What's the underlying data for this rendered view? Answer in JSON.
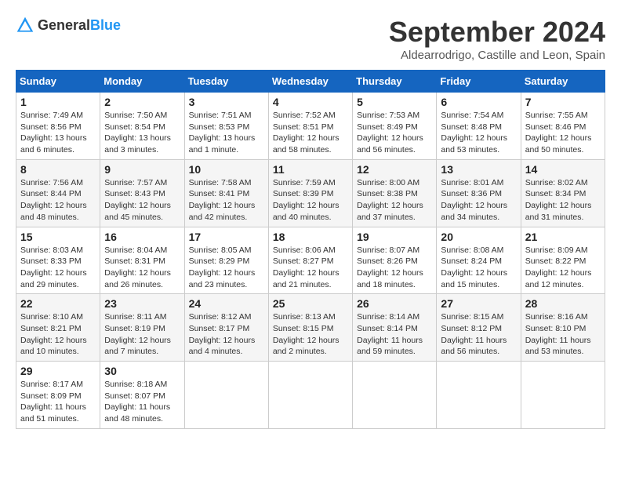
{
  "logo": {
    "text_general": "General",
    "text_blue": "Blue"
  },
  "title": "September 2024",
  "subtitle": "Aldearrodrigo, Castille and Leon, Spain",
  "headers": [
    "Sunday",
    "Monday",
    "Tuesday",
    "Wednesday",
    "Thursday",
    "Friday",
    "Saturday"
  ],
  "weeks": [
    [
      {
        "day": "1",
        "detail": "Sunrise: 7:49 AM\nSunset: 8:56 PM\nDaylight: 13 hours\nand 6 minutes."
      },
      {
        "day": "2",
        "detail": "Sunrise: 7:50 AM\nSunset: 8:54 PM\nDaylight: 13 hours\nand 3 minutes."
      },
      {
        "day": "3",
        "detail": "Sunrise: 7:51 AM\nSunset: 8:53 PM\nDaylight: 13 hours\nand 1 minute."
      },
      {
        "day": "4",
        "detail": "Sunrise: 7:52 AM\nSunset: 8:51 PM\nDaylight: 12 hours\nand 58 minutes."
      },
      {
        "day": "5",
        "detail": "Sunrise: 7:53 AM\nSunset: 8:49 PM\nDaylight: 12 hours\nand 56 minutes."
      },
      {
        "day": "6",
        "detail": "Sunrise: 7:54 AM\nSunset: 8:48 PM\nDaylight: 12 hours\nand 53 minutes."
      },
      {
        "day": "7",
        "detail": "Sunrise: 7:55 AM\nSunset: 8:46 PM\nDaylight: 12 hours\nand 50 minutes."
      }
    ],
    [
      {
        "day": "8",
        "detail": "Sunrise: 7:56 AM\nSunset: 8:44 PM\nDaylight: 12 hours\nand 48 minutes."
      },
      {
        "day": "9",
        "detail": "Sunrise: 7:57 AM\nSunset: 8:43 PM\nDaylight: 12 hours\nand 45 minutes."
      },
      {
        "day": "10",
        "detail": "Sunrise: 7:58 AM\nSunset: 8:41 PM\nDaylight: 12 hours\nand 42 minutes."
      },
      {
        "day": "11",
        "detail": "Sunrise: 7:59 AM\nSunset: 8:39 PM\nDaylight: 12 hours\nand 40 minutes."
      },
      {
        "day": "12",
        "detail": "Sunrise: 8:00 AM\nSunset: 8:38 PM\nDaylight: 12 hours\nand 37 minutes."
      },
      {
        "day": "13",
        "detail": "Sunrise: 8:01 AM\nSunset: 8:36 PM\nDaylight: 12 hours\nand 34 minutes."
      },
      {
        "day": "14",
        "detail": "Sunrise: 8:02 AM\nSunset: 8:34 PM\nDaylight: 12 hours\nand 31 minutes."
      }
    ],
    [
      {
        "day": "15",
        "detail": "Sunrise: 8:03 AM\nSunset: 8:33 PM\nDaylight: 12 hours\nand 29 minutes."
      },
      {
        "day": "16",
        "detail": "Sunrise: 8:04 AM\nSunset: 8:31 PM\nDaylight: 12 hours\nand 26 minutes."
      },
      {
        "day": "17",
        "detail": "Sunrise: 8:05 AM\nSunset: 8:29 PM\nDaylight: 12 hours\nand 23 minutes."
      },
      {
        "day": "18",
        "detail": "Sunrise: 8:06 AM\nSunset: 8:27 PM\nDaylight: 12 hours\nand 21 minutes."
      },
      {
        "day": "19",
        "detail": "Sunrise: 8:07 AM\nSunset: 8:26 PM\nDaylight: 12 hours\nand 18 minutes."
      },
      {
        "day": "20",
        "detail": "Sunrise: 8:08 AM\nSunset: 8:24 PM\nDaylight: 12 hours\nand 15 minutes."
      },
      {
        "day": "21",
        "detail": "Sunrise: 8:09 AM\nSunset: 8:22 PM\nDaylight: 12 hours\nand 12 minutes."
      }
    ],
    [
      {
        "day": "22",
        "detail": "Sunrise: 8:10 AM\nSunset: 8:21 PM\nDaylight: 12 hours\nand 10 minutes."
      },
      {
        "day": "23",
        "detail": "Sunrise: 8:11 AM\nSunset: 8:19 PM\nDaylight: 12 hours\nand 7 minutes."
      },
      {
        "day": "24",
        "detail": "Sunrise: 8:12 AM\nSunset: 8:17 PM\nDaylight: 12 hours\nand 4 minutes."
      },
      {
        "day": "25",
        "detail": "Sunrise: 8:13 AM\nSunset: 8:15 PM\nDaylight: 12 hours\nand 2 minutes."
      },
      {
        "day": "26",
        "detail": "Sunrise: 8:14 AM\nSunset: 8:14 PM\nDaylight: 11 hours\nand 59 minutes."
      },
      {
        "day": "27",
        "detail": "Sunrise: 8:15 AM\nSunset: 8:12 PM\nDaylight: 11 hours\nand 56 minutes."
      },
      {
        "day": "28",
        "detail": "Sunrise: 8:16 AM\nSunset: 8:10 PM\nDaylight: 11 hours\nand 53 minutes."
      }
    ],
    [
      {
        "day": "29",
        "detail": "Sunrise: 8:17 AM\nSunset: 8:09 PM\nDaylight: 11 hours\nand 51 minutes."
      },
      {
        "day": "30",
        "detail": "Sunrise: 8:18 AM\nSunset: 8:07 PM\nDaylight: 11 hours\nand 48 minutes."
      },
      null,
      null,
      null,
      null,
      null
    ]
  ]
}
